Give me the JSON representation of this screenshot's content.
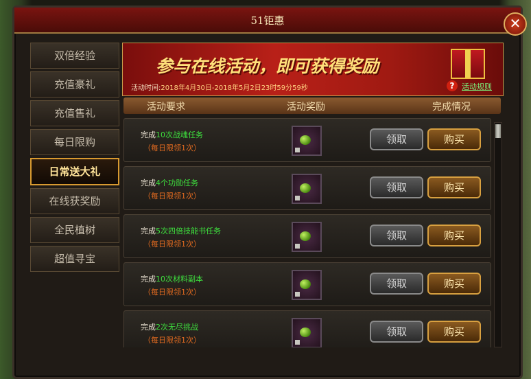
{
  "window": {
    "title": "51钜惠",
    "close_label": "✕"
  },
  "sidebar": {
    "items": [
      {
        "label": "双倍经验"
      },
      {
        "label": "充值豪礼"
      },
      {
        "label": "充值售礼"
      },
      {
        "label": "每日限购"
      },
      {
        "label": "日常送大礼",
        "active": true
      },
      {
        "label": "在线获奖励"
      },
      {
        "label": "全民植树"
      },
      {
        "label": "超值寻宝"
      }
    ]
  },
  "banner": {
    "headline": "参与在线活动，即可获得奖励",
    "time_label": "活动时间:",
    "time_value": "2018年4月30日-2018年5月2日23时59分59秒",
    "rules_label": "活动规则"
  },
  "table_header": {
    "requirement": "活动要求",
    "reward": "活动奖励",
    "status": "完成情况"
  },
  "tasks": [
    {
      "prefix": "完成",
      "task": "10次战魂任务",
      "limit": "（每日限领1次）",
      "claim": "领取",
      "buy": "购买"
    },
    {
      "prefix": "完成",
      "task": "4个功勋任务",
      "limit": "（每日限领1次）",
      "claim": "领取",
      "buy": "购买"
    },
    {
      "prefix": "完成",
      "task": "5次四倍技能书任务",
      "limit": "（每日限领1次）",
      "claim": "领取",
      "buy": "购买"
    },
    {
      "prefix": "完成",
      "task": "10次材料副本",
      "limit": "（每日限领1次）",
      "claim": "领取",
      "buy": "购买"
    },
    {
      "prefix": "完成",
      "task": "2次无尽挑战",
      "limit": "（每日限领1次）",
      "claim": "领取",
      "buy": "购买"
    }
  ],
  "colors": {
    "accent": "#d89a30",
    "task_green": "#3ee03e",
    "limit_orange": "#e06a20"
  }
}
